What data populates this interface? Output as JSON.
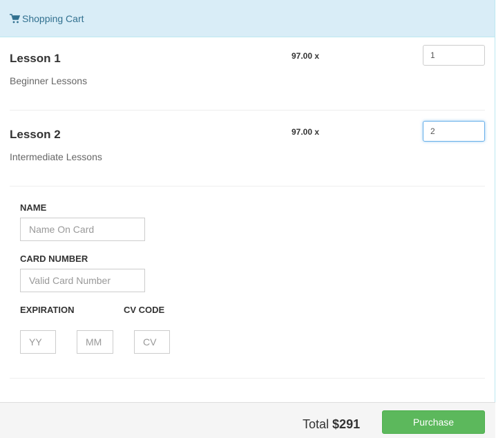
{
  "header": {
    "title": "Shopping Cart",
    "icon": "shopping-cart-icon"
  },
  "items": [
    {
      "name": "Lesson 1",
      "description": "Beginner Lessons",
      "price": "97.00 x",
      "quantity": "1"
    },
    {
      "name": "Lesson 2",
      "description": "Intermediate Lessons",
      "price": "97.00 x",
      "quantity": "2"
    }
  ],
  "form": {
    "name_label": "NAME",
    "name_placeholder": "Name On Card",
    "card_label": "CARD NUMBER",
    "card_placeholder": "Valid Card Number",
    "exp_label": "EXPIRATION",
    "yy_placeholder": "YY",
    "mm_placeholder": "MM",
    "cv_label": "CV CODE",
    "cv_placeholder": "CV"
  },
  "footer": {
    "total_label": "Total",
    "total_value": "$291",
    "purchase_label": "Purchase"
  },
  "colors": {
    "header_bg": "#d9edf7",
    "header_text": "#31708f",
    "purchase": "#5cb85c"
  }
}
